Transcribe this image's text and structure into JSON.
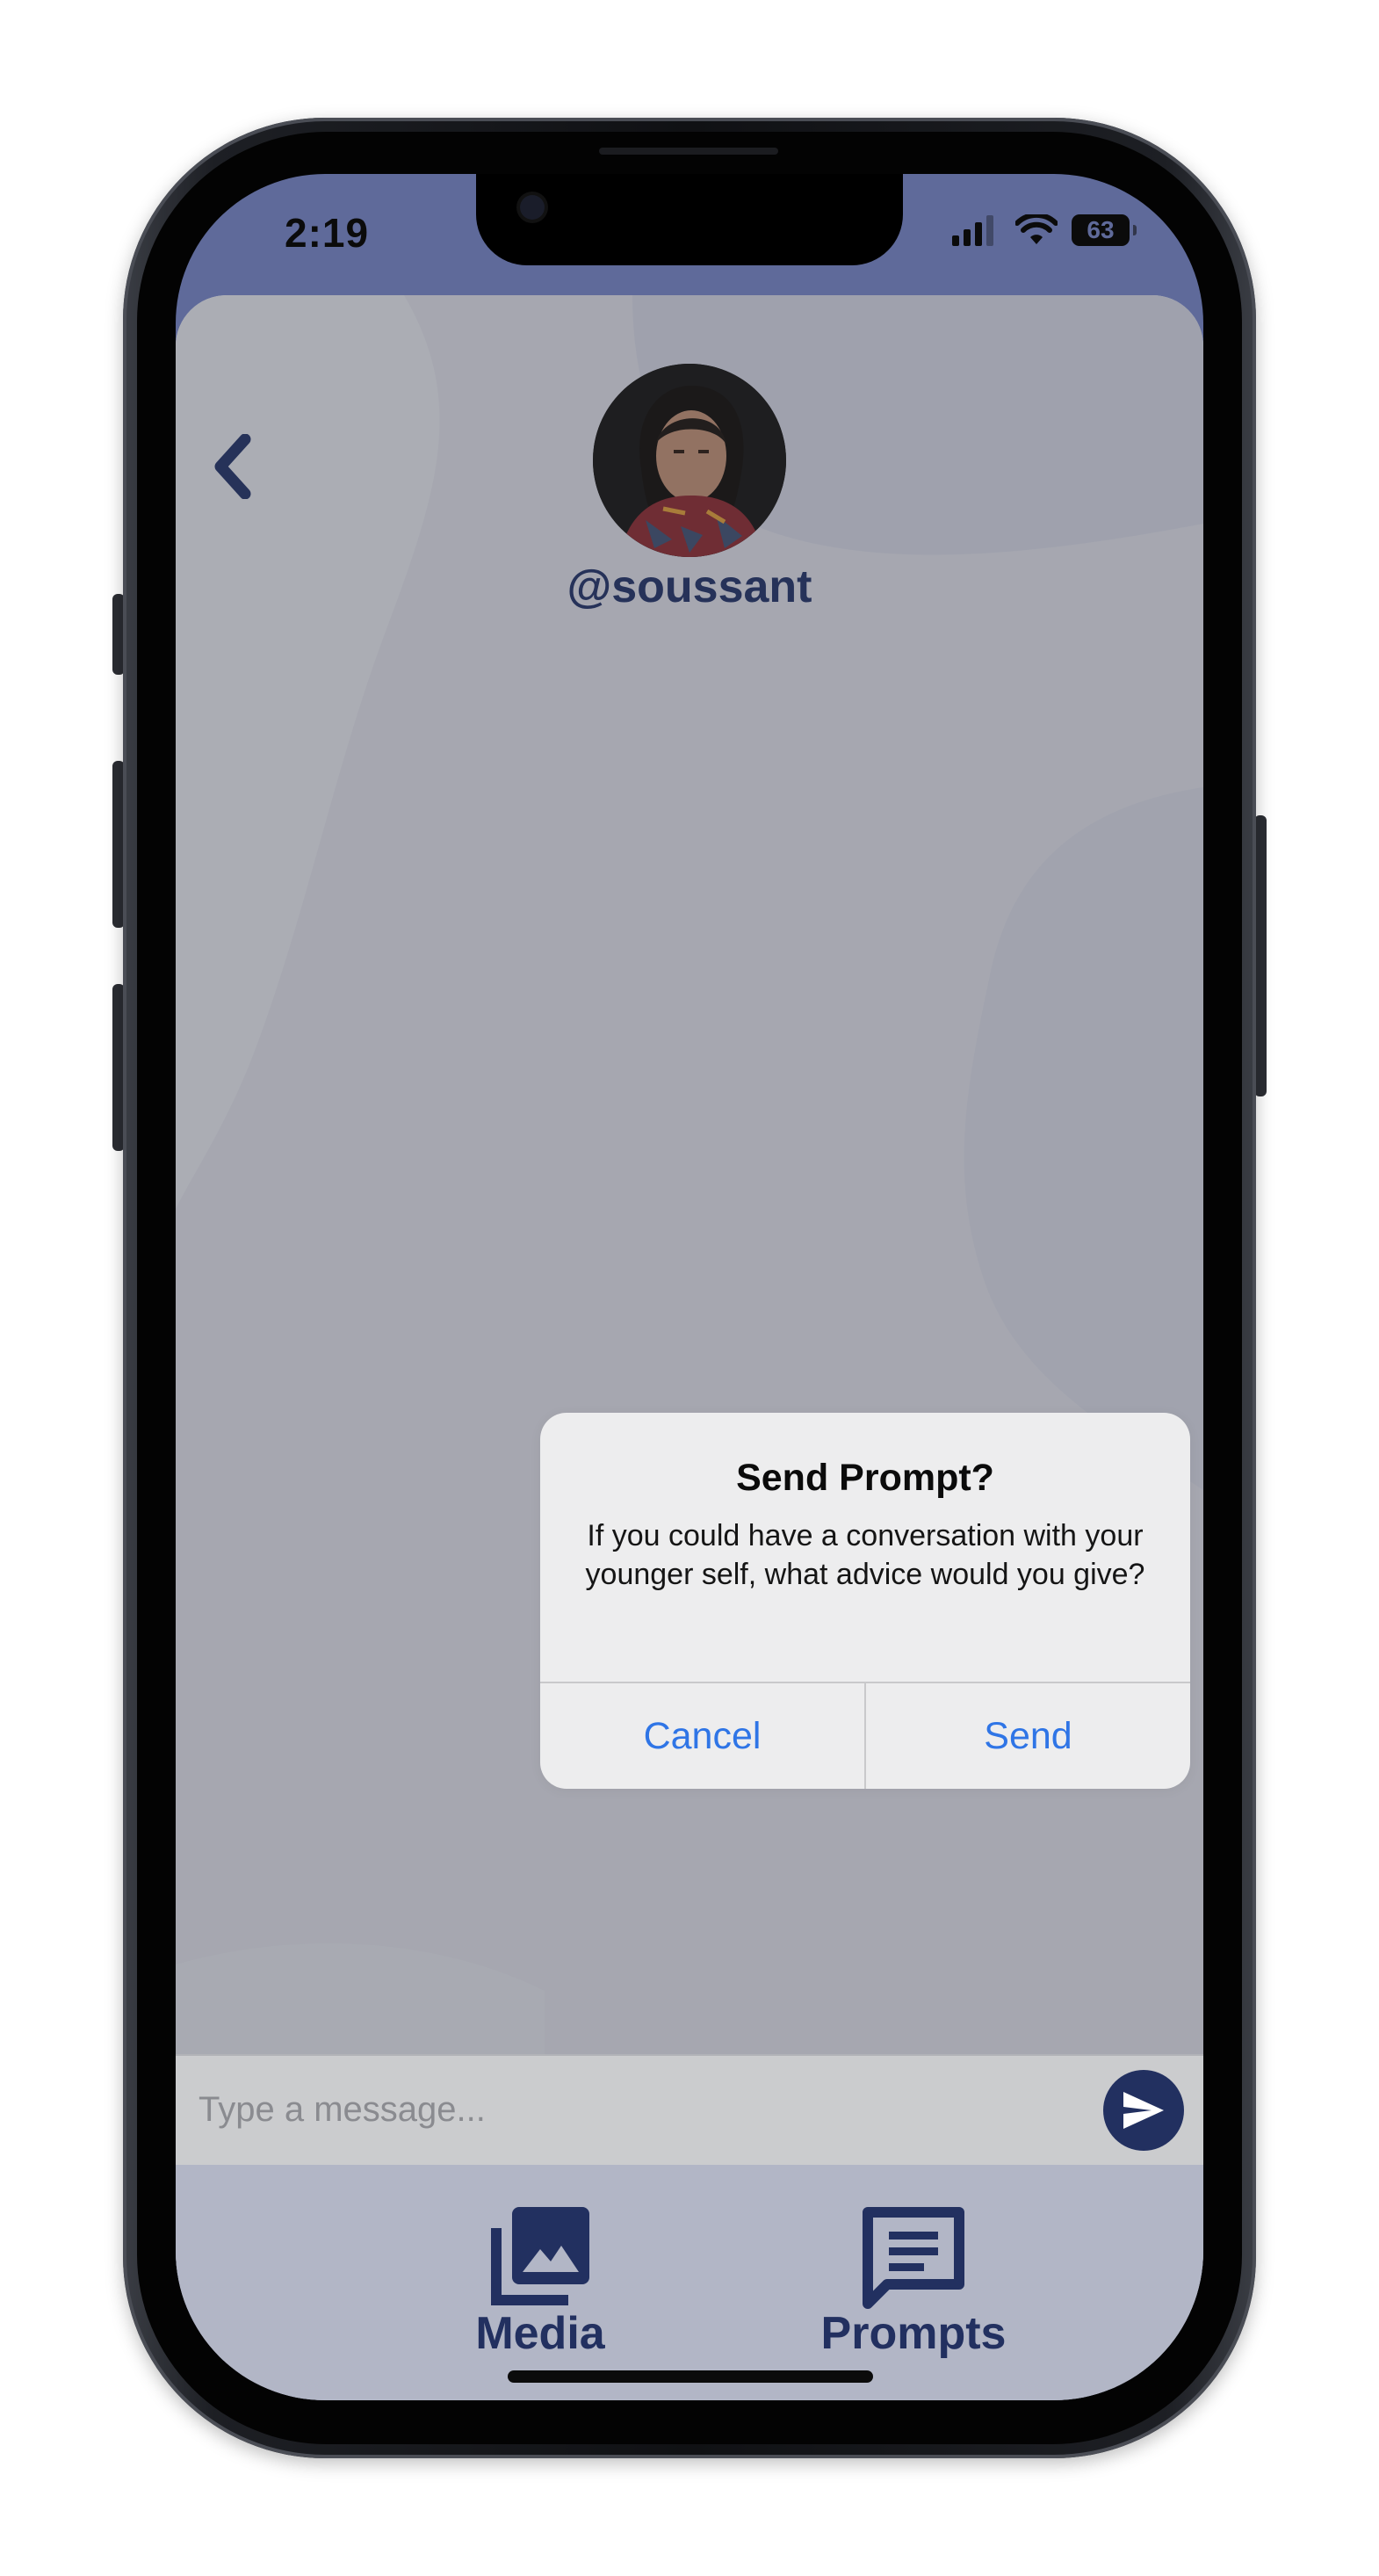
{
  "status_bar": {
    "time": "2:19",
    "battery_level": "63",
    "icons": [
      "cellular-signal-icon",
      "wifi-icon",
      "battery-icon"
    ]
  },
  "header": {
    "back_icon": "chevron-left-icon",
    "username": "@soussant"
  },
  "alert": {
    "title": "Send Prompt?",
    "message": "If you could have a conversation with your younger self, what advice would you give?",
    "cancel_label": "Cancel",
    "send_label": "Send"
  },
  "composer": {
    "placeholder": "Type a message...",
    "send_icon": "paper-plane-icon"
  },
  "tab_bar": {
    "tabs": [
      {
        "label": "Media",
        "icon": "photo-library-icon"
      },
      {
        "label": "Prompts",
        "icon": "chat-bubble-icon"
      }
    ]
  },
  "colors": {
    "accent": "#223060",
    "status_bar_bg": "#5f6a9a",
    "app_bg": "#bdbfca",
    "alert_button_text": "#2f75e6"
  }
}
